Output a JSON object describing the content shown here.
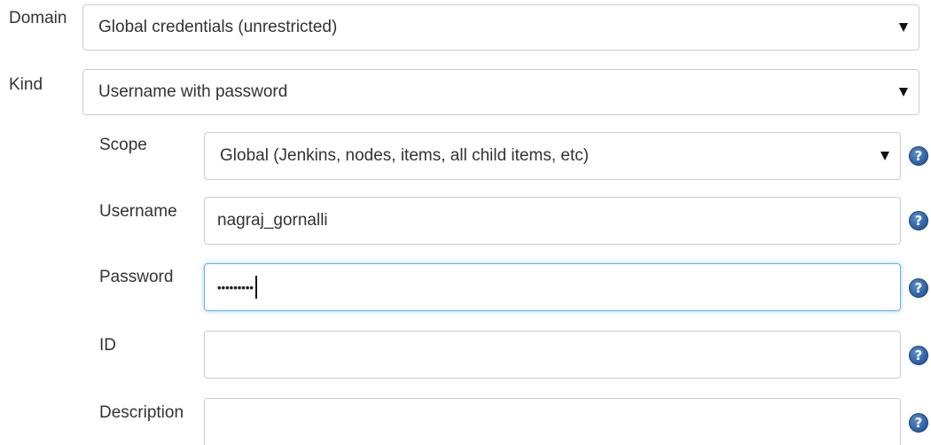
{
  "domain_field": {
    "label": "Domain",
    "value": "Global credentials (unrestricted)"
  },
  "kind_field": {
    "label": "Kind",
    "value": "Username with password"
  },
  "scope_field": {
    "label": "Scope",
    "value": "Global (Jenkins, nodes, items, all child items, etc)",
    "help_icon": "help-icon"
  },
  "username_field": {
    "label": "Username",
    "value": "nagraj_gornalli",
    "help_icon": "help-icon"
  },
  "password_field": {
    "label": "Password",
    "masked_value": "•••••••••",
    "help_icon": "help-icon"
  },
  "id_field": {
    "label": "ID",
    "value": "",
    "help_icon": "help-icon"
  },
  "description_field": {
    "label": "Description",
    "value": "",
    "help_icon": "help-icon"
  },
  "colors": {
    "focus_border": "#66afe9",
    "input_border": "#cccccc",
    "help_icon": "#2f63a8",
    "text": "#333333"
  }
}
